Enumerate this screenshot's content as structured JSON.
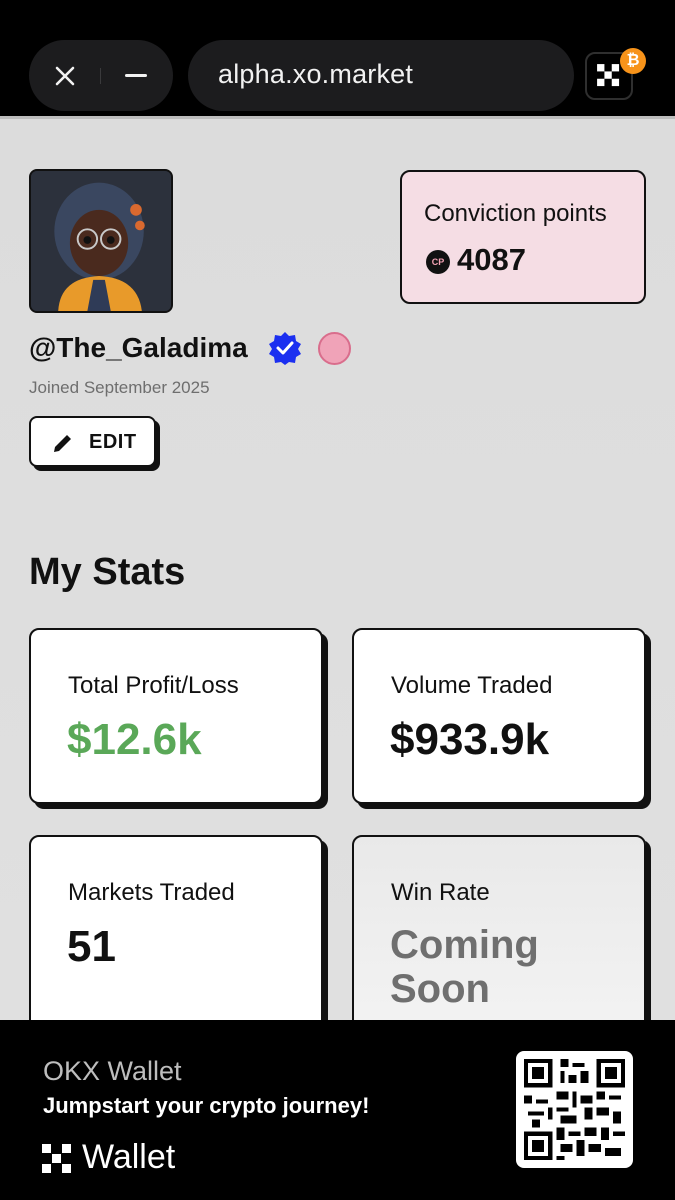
{
  "browser": {
    "url": "alpha.xo.market",
    "close_icon": "close-icon",
    "minimize_icon": "minimize-icon",
    "app_icon": "okx-logo-icon",
    "badge_icon": "bitcoin-icon",
    "badge_glyph": "₿"
  },
  "profile": {
    "username": "@The_Galadima",
    "joined": "Joined September 2025",
    "edit_label": "EDIT",
    "verified_icon": "verified-badge-icon",
    "badge_icon": "pink-badge-icon"
  },
  "conviction": {
    "label": "Conviction points",
    "icon_text": "CP",
    "value": "4087"
  },
  "stats": {
    "title": "My Stats",
    "cards": [
      {
        "label": "Total Profit/Loss",
        "value": "$12.6k",
        "color": "#5aa858"
      },
      {
        "label": "Volume Traded",
        "value": "$933.9k"
      },
      {
        "label": "Markets Traded",
        "value": "51"
      },
      {
        "label": "Win Rate",
        "value_line1": "Coming",
        "value_line2": "Soon"
      }
    ]
  },
  "wallet_banner": {
    "title": "OKX Wallet",
    "subtitle": "Jumpstart your crypto journey!",
    "brand": "Wallet",
    "qr_icon": "qr-code-icon"
  }
}
